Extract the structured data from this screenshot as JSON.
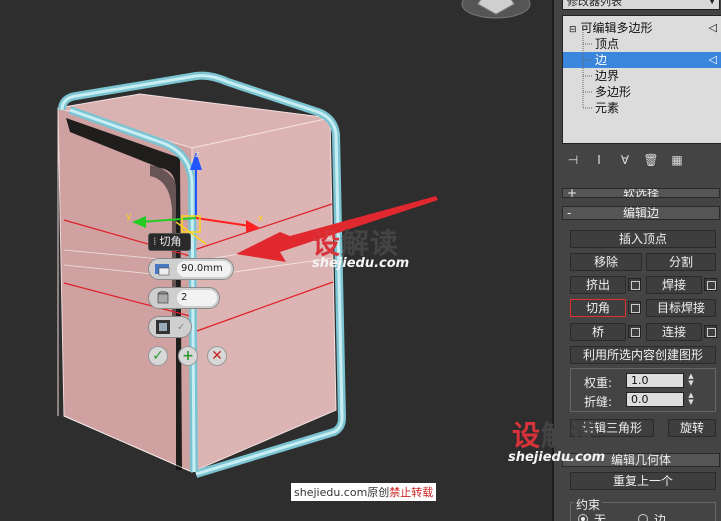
{
  "caddy": {
    "title": "切角",
    "amount": "90.0mm",
    "segments": "2",
    "ok_icon": "checkmark-icon",
    "apply_icon": "plus-icon",
    "cancel_icon": "x-icon"
  },
  "axes": {
    "x": "x",
    "y": "y",
    "z": "z"
  },
  "watermarks": {
    "logo_a": "设",
    "logo_b": "解读",
    "url": "shejiedu.com",
    "credit_prefix": "shejiedu.com原创",
    "credit_red": "禁止转载"
  },
  "panel": {
    "modifier_list": "修改器列表",
    "stack": {
      "root": "可编辑多边形",
      "items": [
        "顶点",
        "边",
        "边界",
        "多边形",
        "元素"
      ],
      "selected_index": 1
    },
    "soft_selection": "软选择",
    "edit_edges": {
      "title": "编辑边",
      "insert_vertex": "插入顶点",
      "remove": "移除",
      "split": "分割",
      "extrude": "挤出",
      "weld": "焊接",
      "chamfer": "切角",
      "target_weld": "目标焊接",
      "bridge": "桥",
      "connect": "连接",
      "create_shape": "利用所选内容创建图形",
      "weight_label": "权重:",
      "weight_value": "1.0",
      "crease_label": "折缝:",
      "crease_value": "0.0",
      "edit_tri": "编辑三角形",
      "turn": "旋转"
    },
    "edit_geometry": {
      "title": "编辑几何体",
      "repeat_last": "重复上一个",
      "constraints": "约束",
      "none": "无",
      "edge": "边"
    }
  },
  "colors": {
    "box_face": "#d9aeae",
    "edge_red": "#e0202a",
    "tube": "#9fd8e2",
    "selection_blue": "#3a86dd"
  }
}
